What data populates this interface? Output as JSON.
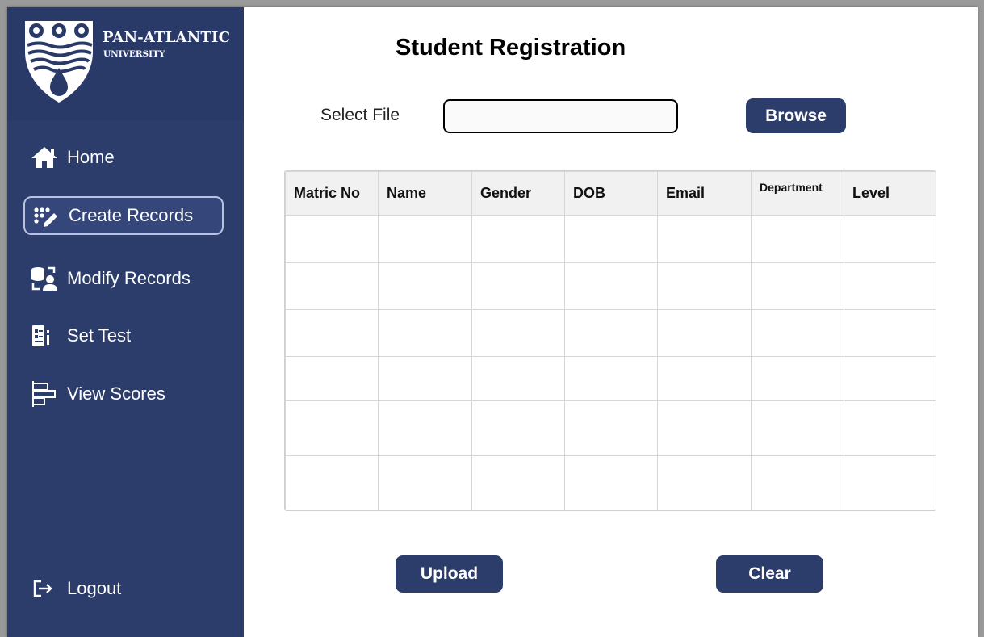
{
  "brand": {
    "name": "PAN-ATLANTIC",
    "subtitle": "UNIVERSITY"
  },
  "sidebar": {
    "items": [
      {
        "label": "Home",
        "icon": "home-icon"
      },
      {
        "label": "Create Records",
        "icon": "create-records-icon",
        "active": true
      },
      {
        "label": "Modify Records",
        "icon": "modify-records-icon"
      },
      {
        "label": "Set Test",
        "icon": "test-sheet-icon"
      },
      {
        "label": "View Scores",
        "icon": "bar-chart-icon"
      }
    ],
    "logout": {
      "label": "Logout",
      "icon": "logout-icon"
    }
  },
  "main": {
    "title": "Student Registration",
    "file": {
      "label": "Select File",
      "value": "",
      "placeholder": ""
    },
    "browse_label": "Browse",
    "table": {
      "columns": [
        "Matric No",
        "Name",
        "Gender",
        "DOB",
        "Email",
        "Department",
        "Level"
      ],
      "rows": [
        [
          "",
          "",
          "",
          "",
          "",
          "",
          ""
        ],
        [
          "",
          "",
          "",
          "",
          "",
          "",
          ""
        ],
        [
          "",
          "",
          "",
          "",
          "",
          "",
          ""
        ],
        [
          "",
          "",
          "",
          "",
          "",
          "",
          ""
        ],
        [
          "",
          "",
          "",
          "",
          "",
          "",
          ""
        ],
        [
          "",
          "",
          "",
          "",
          "",
          "",
          ""
        ]
      ]
    },
    "upload_label": "Upload",
    "clear_label": "Clear"
  },
  "colors": {
    "sidebar": "#2c3d6c",
    "button": "#2c3d6c",
    "table_header": "#f1f1f1"
  }
}
